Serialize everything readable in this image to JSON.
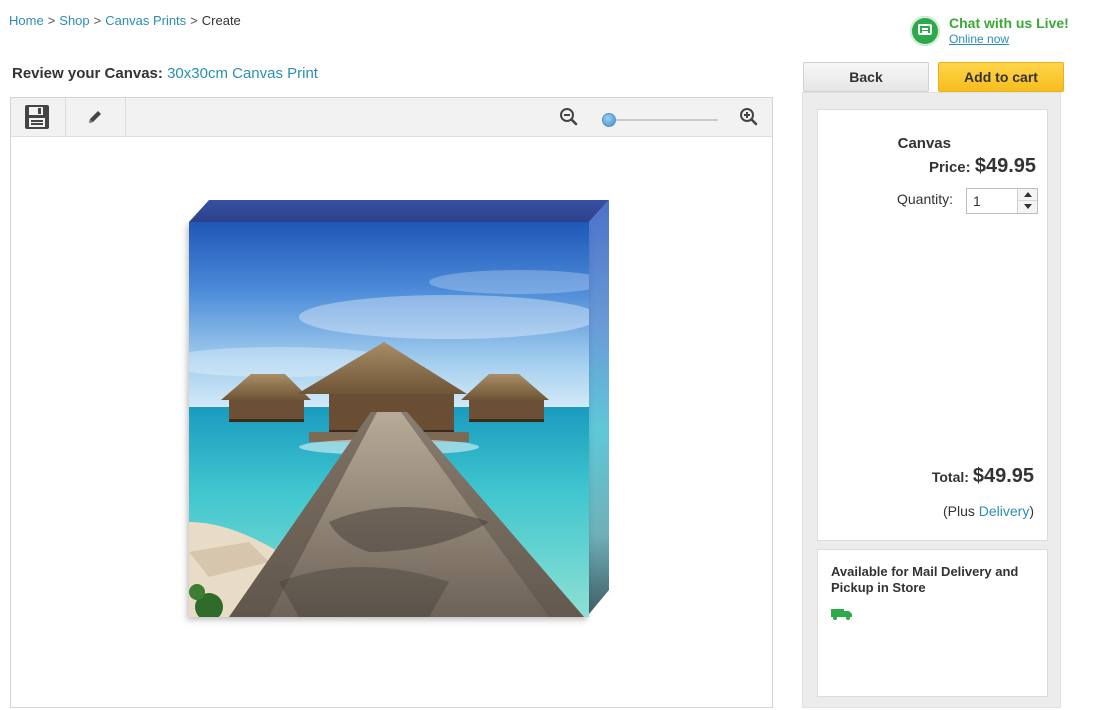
{
  "breadcrumb": {
    "items": [
      "Home",
      "Shop",
      "Canvas Prints"
    ],
    "separator": ">",
    "current": "Create"
  },
  "chat": {
    "title": "Chat with us Live!",
    "subtitle": "Online now",
    "icon": "chat-bubble-icon",
    "color": "#39a935"
  },
  "review": {
    "label": "Review your Canvas:",
    "product": "30x30cm Canvas Print"
  },
  "toolbar": {
    "icons": [
      "save-icon",
      "pencil-icon",
      "zoom-out-icon",
      "zoom-in-icon"
    ],
    "zoom_level": 0.0
  },
  "canvas_preview": {
    "image": "tropical over-water bungalows with boardwalk on turquoise sea"
  },
  "actions": {
    "back_label": "Back",
    "add_to_cart_label": "Add to cart",
    "accent_color": "#f7bd1e"
  },
  "price_panel": {
    "product_name": "Canvas",
    "price_label": "Price:",
    "price": "$49.95",
    "quantity_label": "Quantity:",
    "quantity_value": "1",
    "total_label": "Total:",
    "total": "$49.95",
    "delivery_prefix": "(Plus",
    "delivery_link": "Delivery",
    "delivery_suffix": ")"
  },
  "availability": {
    "text": "Available for Mail Delivery and Pickup in Store",
    "icon": "truck-icon",
    "icon_color": "#2da84a"
  },
  "colors": {
    "link": "#2a8fb5",
    "chat_green": "#39a935"
  }
}
